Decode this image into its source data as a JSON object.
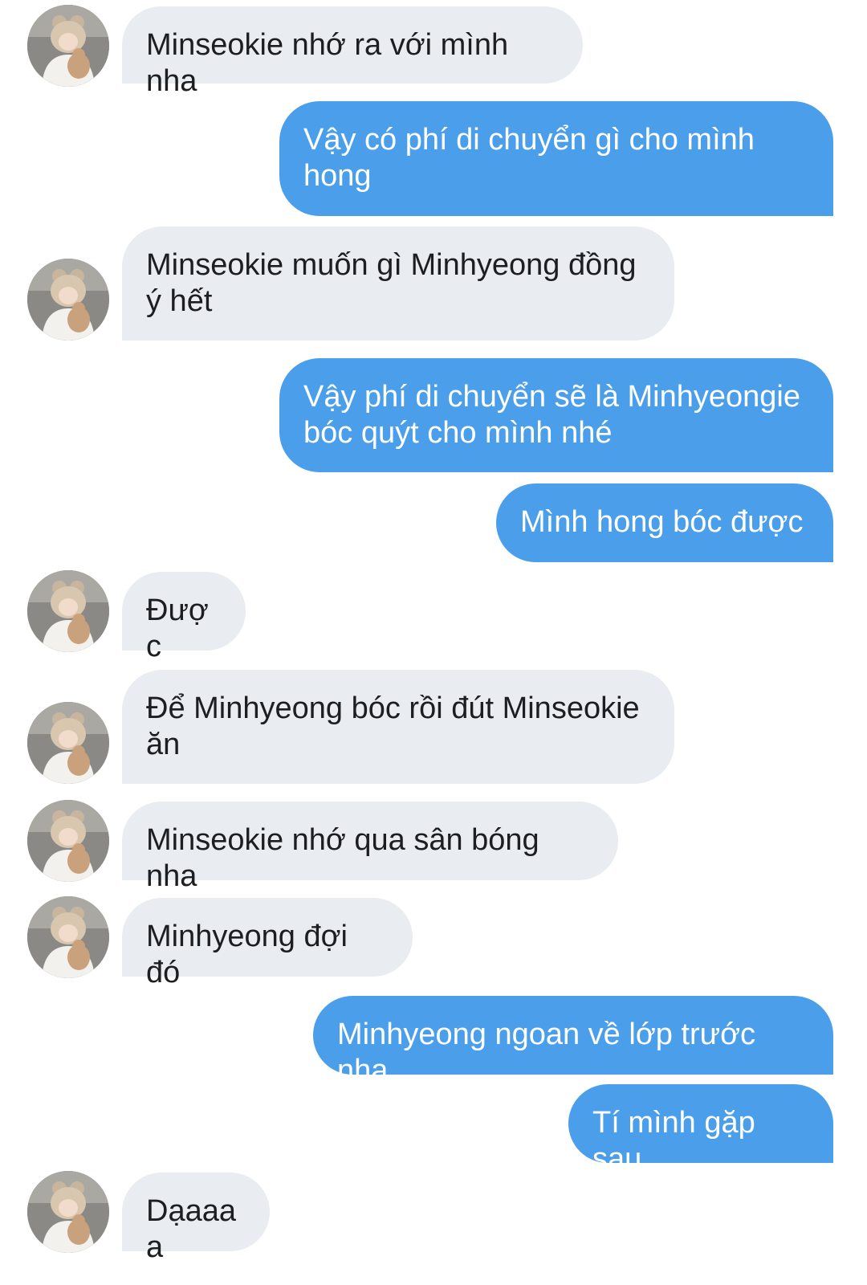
{
  "messages": [
    {
      "sender": "other",
      "text": "Minseokie nhớ ra với mình nha"
    },
    {
      "sender": "self",
      "text": "Vậy có phí di chuyển gì cho mình hong"
    },
    {
      "sender": "other",
      "text": "Minseokie muốn gì Minhyeong đồng ý hết"
    },
    {
      "sender": "self",
      "text": "Vậy phí di chuyển sẽ là Minhyeongie bóc quýt cho mình nhé"
    },
    {
      "sender": "self",
      "text": "Mình hong bóc được"
    },
    {
      "sender": "other",
      "text": "Được"
    },
    {
      "sender": "other",
      "text": "Để Minhyeong bóc rồi đút Minseokie ăn"
    },
    {
      "sender": "other",
      "text": "Minseokie nhớ qua sân bóng nha"
    },
    {
      "sender": "other",
      "text": "Minhyeong đợi đó"
    },
    {
      "sender": "self",
      "text": "Minhyeong ngoan về lớp trước nha"
    },
    {
      "sender": "self",
      "text": "Tí mình gặp sau"
    },
    {
      "sender": "other",
      "text": "Dạaaaa"
    }
  ],
  "colors": {
    "incoming_bubble": "#e9ecf0",
    "outgoing_bubble": "#4b9fea",
    "incoming_text": "#1c1e21",
    "outgoing_text": "#ffffff"
  },
  "avatar_icon": "avatar-photo-person-with-teddy-bear"
}
